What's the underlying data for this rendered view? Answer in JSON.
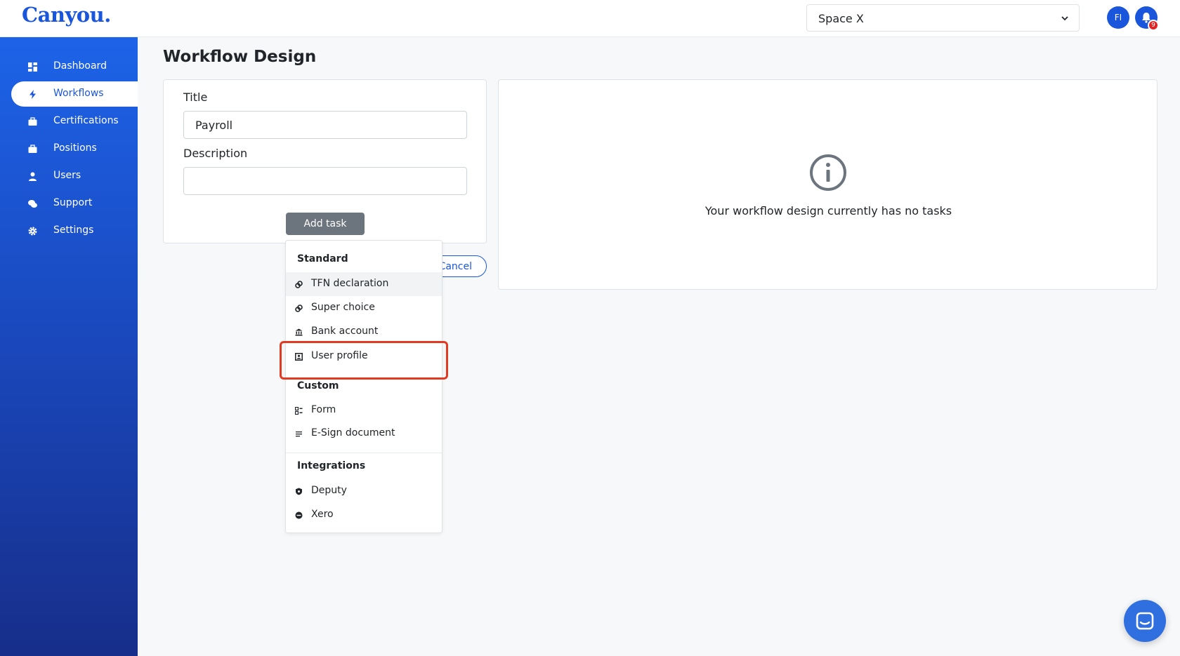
{
  "app": {
    "logo": "Canyou."
  },
  "header": {
    "space_select": {
      "value": "Space X"
    },
    "avatar_initials": "FI",
    "notification_count": "9"
  },
  "sidebar": {
    "items": [
      {
        "label": "Dashboard",
        "icon": "dashboard-icon",
        "active": false
      },
      {
        "label": "Workflows",
        "icon": "bolt-icon",
        "active": true
      },
      {
        "label": "Certifications",
        "icon": "briefcase-icon",
        "active": false
      },
      {
        "label": "Positions",
        "icon": "briefcase-icon",
        "active": false
      },
      {
        "label": "Users",
        "icon": "user-icon",
        "active": false
      },
      {
        "label": "Support",
        "icon": "chat-icon",
        "active": false
      },
      {
        "label": "Settings",
        "icon": "gear-icon",
        "active": false
      }
    ]
  },
  "page": {
    "title": "Workflow Design"
  },
  "form": {
    "title_label": "Title",
    "title_value": "Payroll",
    "description_label": "Description",
    "description_value": "",
    "add_task_label": "Add task",
    "cancel_label": "Cancel"
  },
  "empty_state": {
    "icon": "info-icon",
    "message": "Your workflow design currently has no tasks"
  },
  "dropdown": {
    "standard_header": "Standard",
    "standard_items": [
      {
        "label": "TFN declaration",
        "icon": "link-icon"
      },
      {
        "label": "Super choice",
        "icon": "link-icon"
      },
      {
        "label": "Bank account",
        "icon": "bank-icon"
      },
      {
        "label": "User profile",
        "icon": "profile-icon"
      }
    ],
    "custom_header": "Custom",
    "custom_items": [
      {
        "label": "Form",
        "icon": "form-icon"
      },
      {
        "label": "E-Sign document",
        "icon": "document-icon"
      }
    ],
    "integrations_header": "Integrations",
    "integration_items": [
      {
        "label": "Deputy",
        "icon": "shield-icon"
      },
      {
        "label": "Xero",
        "icon": "xero-icon"
      }
    ]
  },
  "colors": {
    "brand": "#1a56db",
    "highlight": "#e03a23",
    "add_task_bg": "#6c757d"
  }
}
